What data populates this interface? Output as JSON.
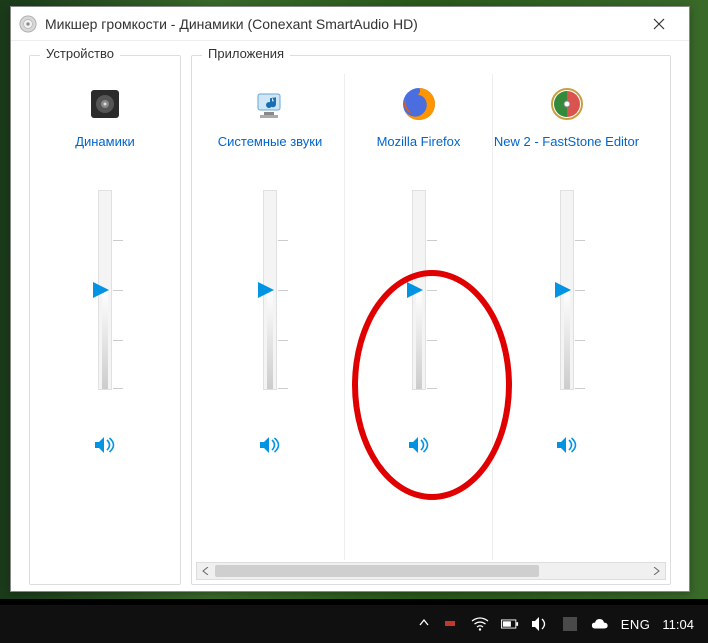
{
  "window": {
    "title": "Микшер громкости - Динамики (Conexant SmartAudio HD)"
  },
  "groups": {
    "device_label": "Устройство",
    "apps_label": "Приложения"
  },
  "channels": [
    {
      "name": "Динамики",
      "level": 50,
      "muted": false,
      "icon": "speaker-device"
    },
    {
      "name": "Системные звуки",
      "level": 50,
      "muted": false,
      "icon": "system-sounds"
    },
    {
      "name": "Mozilla Firefox",
      "level": 50,
      "muted": false,
      "icon": "firefox"
    },
    {
      "name": "New 2 - FastStone Editor",
      "level": 50,
      "muted": false,
      "icon": "faststone"
    }
  ],
  "taskbar": {
    "language": "ENG",
    "time": "11:04"
  },
  "colors": {
    "accent": "#0294e3",
    "link": "#0066cc",
    "annotation": "#e00000"
  }
}
